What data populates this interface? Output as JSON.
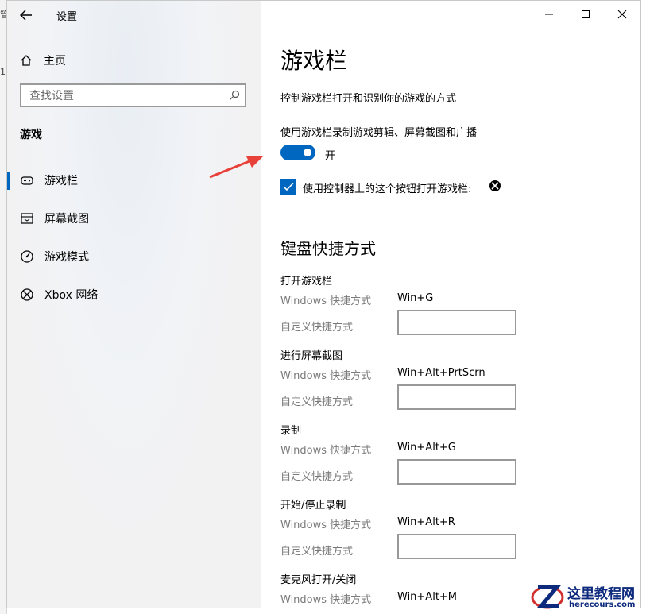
{
  "background": {
    "fragments": [
      "管",
      "1"
    ]
  },
  "window": {
    "app_title": "设置",
    "controls": {
      "minimize": "minimize-icon",
      "maximize": "maximize-icon",
      "close": "close-icon"
    }
  },
  "sidebar": {
    "home_label": "主页",
    "search_placeholder": "查找设置",
    "section_heading": "游戏",
    "items": [
      {
        "label": "游戏栏",
        "icon": "game-bar-icon",
        "active": true
      },
      {
        "label": "屏幕截图",
        "icon": "captures-icon",
        "active": false
      },
      {
        "label": "游戏模式",
        "icon": "game-mode-icon",
        "active": false
      },
      {
        "label": "Xbox 网络",
        "icon": "xbox-icon",
        "active": false
      }
    ]
  },
  "main": {
    "title": "游戏栏",
    "description": "控制游戏栏打开和识别你的游戏的方式",
    "toggle": {
      "caption": "使用游戏栏录制游戏剪辑、屏幕截图和广播",
      "state_label": "开",
      "on": true
    },
    "checkbox": {
      "label": "使用控制器上的这个按钮打开游戏栏:",
      "checked": true
    },
    "keyboard_title": "键盘快捷方式",
    "windows_shortcut_label": "Windows 快捷方式",
    "custom_shortcut_label": "自定义快捷方式",
    "shortcuts": [
      {
        "title": "打开游戏栏",
        "windows": "Win+G",
        "custom": ""
      },
      {
        "title": "进行屏幕截图",
        "windows": "Win+Alt+PrtScrn",
        "custom": ""
      },
      {
        "title": "录制",
        "windows": "Win+Alt+G",
        "custom": ""
      },
      {
        "title": "开始/停止录制",
        "windows": "Win+Alt+R",
        "custom": ""
      },
      {
        "title": "麦克风打开/关闭",
        "windows": "Win+Alt+M",
        "custom": ""
      }
    ]
  },
  "watermark": {
    "title": "这里教程网",
    "url": "herecours.com"
  },
  "colors": {
    "accent": "#0067c0",
    "arrow": "#e8413a"
  }
}
